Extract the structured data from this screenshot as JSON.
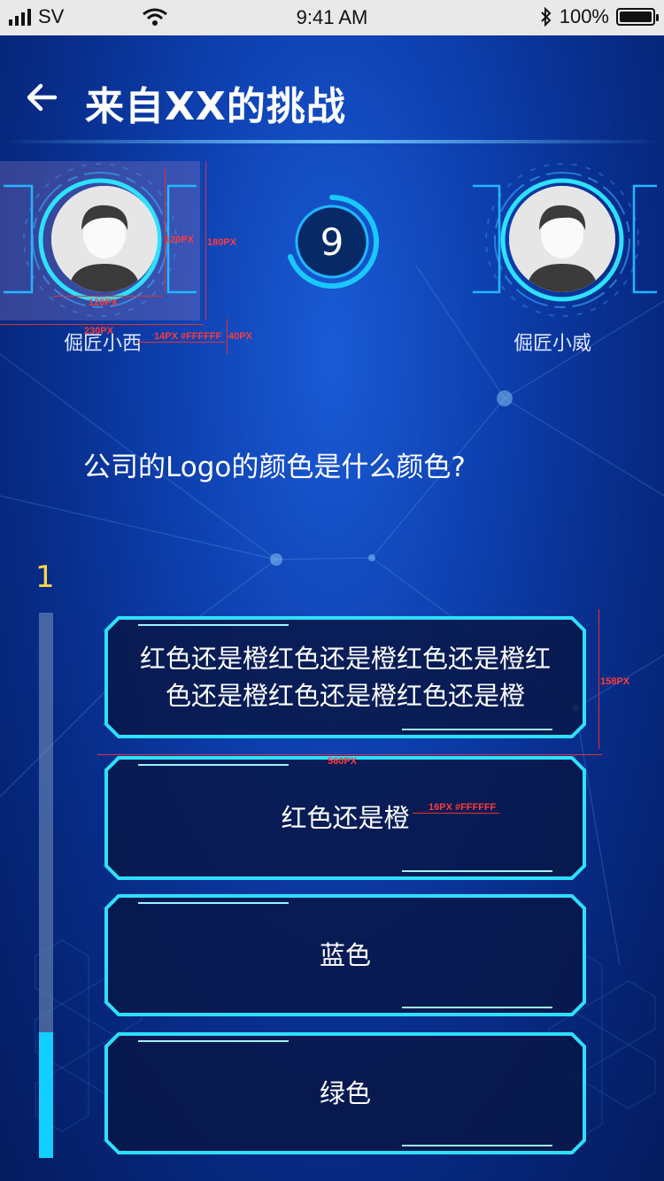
{
  "status_bar": {
    "carrier": "SV",
    "time": "9:41 AM",
    "battery": "100%"
  },
  "header": {
    "back_icon": "arrow-left-icon",
    "title": "来自XX的挑战"
  },
  "players": {
    "left": {
      "name": "倔匠小西",
      "avatar_icon": "user-avatar-icon"
    },
    "right": {
      "name": "倔匠小威",
      "avatar_icon": "user-avatar-icon"
    }
  },
  "timer": {
    "value": "9"
  },
  "question": {
    "text": "公司的Logo的颜色是什么颜色?"
  },
  "progress": {
    "count": "1",
    "fill_fraction": 0.23
  },
  "options": [
    {
      "label": "红色还是橙红色还是橙红色还是橙红色还是橙红色还是橙红色还是橙"
    },
    {
      "label": "红色还是橙"
    },
    {
      "label": "蓝色"
    },
    {
      "label": "绿色"
    }
  ],
  "annotations": {
    "avatar_w": "120PX",
    "avatar_h": "120PX",
    "frame_h": "180PX",
    "frame_w": "230PX",
    "name_spec": "14PX #FFFFFF",
    "name_h": "40PX",
    "option_h": "158PX",
    "option_w": "560PX",
    "option_spec": "16PX #FFFFFF"
  },
  "colors": {
    "accent": "#11cfff",
    "progress_count": "#f6d44a",
    "annotation": "#ff3b3b"
  }
}
